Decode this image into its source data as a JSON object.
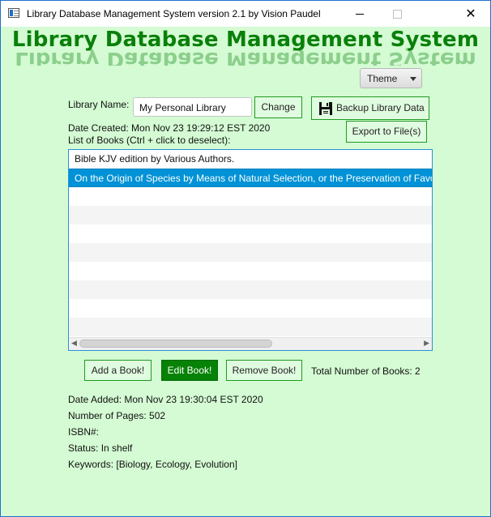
{
  "window": {
    "title": "Library Database Management System version 2.1 by Vision Paudel",
    "minimize": "minimize",
    "maximize": "maximize",
    "close": "✕"
  },
  "header": {
    "title": "Library Database Management System"
  },
  "theme": {
    "label": "Theme"
  },
  "library": {
    "name_label": "Library Name:",
    "name_value": "My Personal Library",
    "change_button": "Change",
    "backup_button": "Backup Library Data",
    "export_button": "Export to File(s)",
    "date_created": "Date Created: Mon Nov 23 19:29:12 EST 2020",
    "list_label": "List of Books (Ctrl + click to deselect):"
  },
  "books": [
    {
      "label": "Bible KJV edition by Various Authors.",
      "selected": false
    },
    {
      "label": "On the Origin of Species by Means of Natural Selection, or the Preservation of Favo",
      "selected": true
    }
  ],
  "actions": {
    "add": "Add a Book!",
    "edit": "Edit Book!",
    "remove": "Remove Book!",
    "total": "Total Number of Books: 2"
  },
  "details": {
    "date_added": "Date Added: Mon Nov 23 19:30:04 EST 2020",
    "pages": "Number of Pages: 502",
    "isbn": "ISBN#:",
    "status": "Status: In shelf",
    "keywords": "Keywords: [Biology, Ecology, Evolution]"
  },
  "colors": {
    "background": "#d4fbd3",
    "accent_green": "#0a800a",
    "selection_blue": "#0092d6"
  },
  "icons": {
    "app": "app-window-icon",
    "backup": "save-disk-icon",
    "combo_arrow": "chevron-down-icon"
  }
}
